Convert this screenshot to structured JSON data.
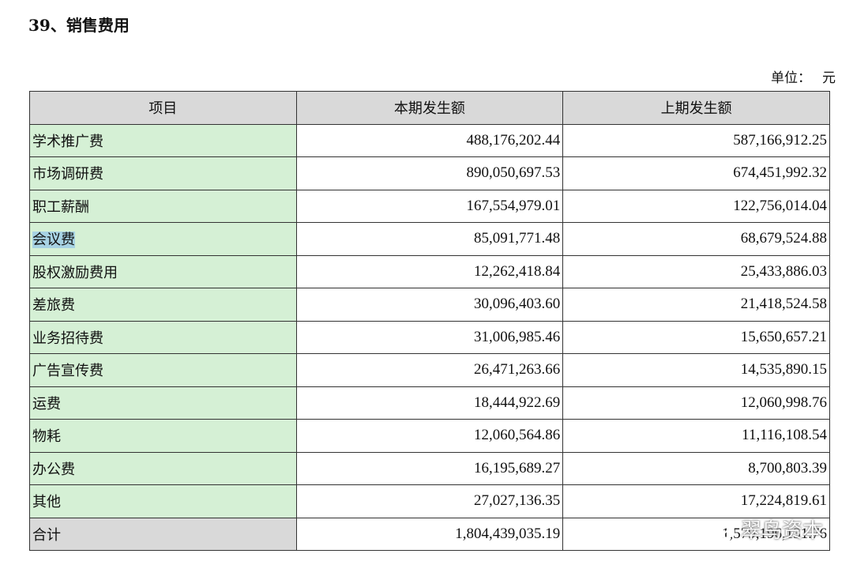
{
  "heading": "39、销售费用",
  "unit": {
    "label": "单位：",
    "value": "元"
  },
  "table": {
    "headers": [
      "项目",
      "本期发生额",
      "上期发生额"
    ],
    "rows": [
      {
        "item": "学术推广费",
        "current": "488,176,202.44",
        "previous": "587,166,912.25"
      },
      {
        "item": "市场调研费",
        "current": "890,050,697.53",
        "previous": "674,451,992.32"
      },
      {
        "item": "职工薪酬",
        "current": "167,554,979.01",
        "previous": "122,756,014.04"
      },
      {
        "item": "会议费",
        "current": "85,091,771.48",
        "previous": "68,679,524.88"
      },
      {
        "item": "股权激励费用",
        "current": "12,262,418.84",
        "previous": "25,433,886.03"
      },
      {
        "item": "差旅费",
        "current": "30,096,403.60",
        "previous": "21,418,524.58"
      },
      {
        "item": "业务招待费",
        "current": "31,006,985.46",
        "previous": "15,650,657.21"
      },
      {
        "item": "广告宣传费",
        "current": "26,471,263.66",
        "previous": "14,535,890.15"
      },
      {
        "item": "运费",
        "current": "18,444,922.69",
        "previous": "12,060,998.76"
      },
      {
        "item": "物耗",
        "current": "12,060,564.86",
        "previous": "11,116,108.54"
      },
      {
        "item": "办公费",
        "current": "16,195,689.27",
        "previous": "8,700,803.39"
      },
      {
        "item": "其他",
        "current": "27,027,136.35",
        "previous": "17,224,819.61"
      }
    ],
    "total": {
      "item": "合计",
      "current": "1,804,439,035.19",
      "previous": "1,579,196,131.76"
    }
  },
  "watermark": {
    "text": "翠鸟资本",
    "icon": "wechat-icon"
  },
  "colors": {
    "item_bg": "#d5f0d5",
    "header_bg": "#d9d9d9",
    "selection": "#a7d2e3"
  }
}
